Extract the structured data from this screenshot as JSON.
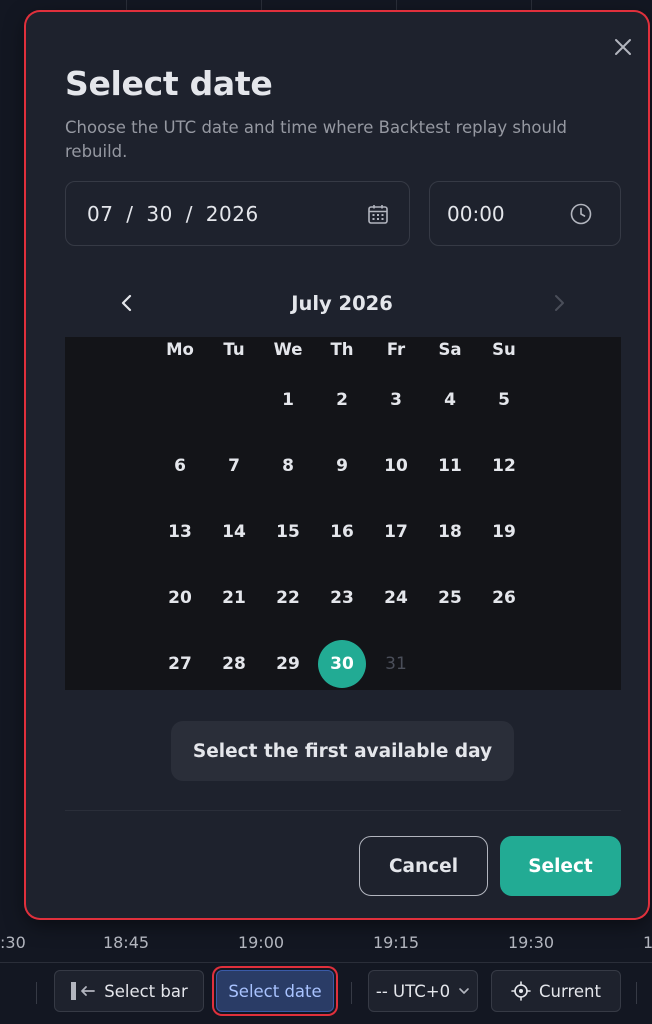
{
  "dialog": {
    "title": "Select date",
    "subtitle": "Choose the UTC date and time where Backtest replay should rebuild.",
    "date_value": "07 / 30 / 2026",
    "time_value": "00:00",
    "month_label": "July 2026",
    "weekdays": [
      "Mo",
      "Tu",
      "We",
      "Th",
      "Fr",
      "Sa",
      "Su"
    ],
    "weeks": [
      [
        "",
        "",
        "1",
        "2",
        "3",
        "4",
        "5"
      ],
      [
        "6",
        "7",
        "8",
        "9",
        "10",
        "11",
        "12"
      ],
      [
        "13",
        "14",
        "15",
        "16",
        "17",
        "18",
        "19"
      ],
      [
        "20",
        "21",
        "22",
        "23",
        "24",
        "25",
        "26"
      ],
      [
        "27",
        "28",
        "29",
        "30",
        "31",
        "",
        ""
      ]
    ],
    "selected_day": "30",
    "disabled_days": [
      "31"
    ],
    "first_day_label": "Select the first available day",
    "cancel_label": "Cancel",
    "select_label": "Select"
  },
  "axis": {
    "labels": [
      ":30",
      "18:45",
      "19:00",
      "19:15",
      "19:30",
      "1"
    ]
  },
  "toolbar": {
    "select_bar_label": "Select bar",
    "select_date_label": "Select date",
    "timezone_label": "-- UTC+0",
    "current_label": "Current"
  },
  "colors": {
    "accent": "#22ab94",
    "highlight_border": "#e0303c",
    "dialog_bg": "#1e222d",
    "page_bg": "#131722"
  }
}
